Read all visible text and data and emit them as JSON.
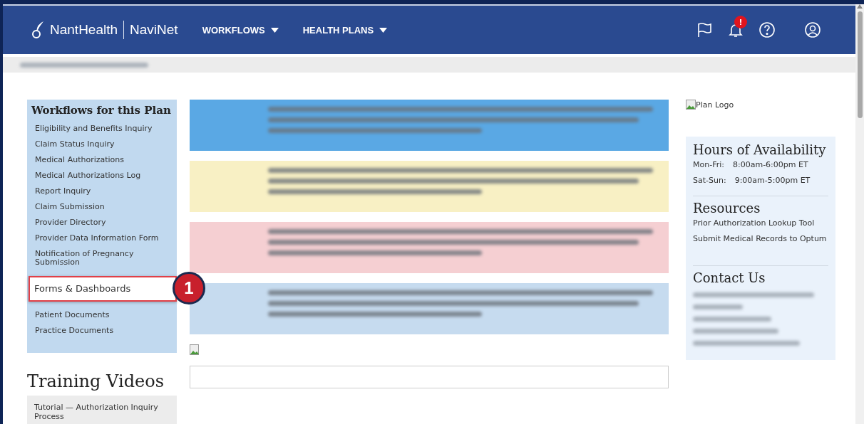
{
  "header": {
    "logo_brand": "NantHealth",
    "logo_product": "NaviNet",
    "nav": [
      {
        "label": "WORKFLOWS"
      },
      {
        "label": "HEALTH PLANS"
      }
    ],
    "notification_badge": "!"
  },
  "workflows": {
    "title": "Workflows for this Plan",
    "items": [
      {
        "label": "Eligibility and Benefits Inquiry",
        "selected": false
      },
      {
        "label": "Claim Status Inquiry",
        "selected": false
      },
      {
        "label": "Medical Authorizations",
        "selected": false
      },
      {
        "label": "Medical Authorizations Log",
        "selected": false
      },
      {
        "label": "Report Inquiry",
        "selected": false
      },
      {
        "label": "Claim Submission",
        "selected": false
      },
      {
        "label": "Provider Directory",
        "selected": false
      },
      {
        "label": "Provider Data Information Form",
        "selected": false
      },
      {
        "label": "Notification of Pregnancy Submission",
        "selected": false
      },
      {
        "label": "Forms & Dashboards",
        "selected": true,
        "callout": "1"
      },
      {
        "label": "Patient Documents",
        "selected": false
      },
      {
        "label": "Practice Documents",
        "selected": false
      }
    ]
  },
  "training": {
    "title": "Training Videos",
    "items": [
      {
        "label": "Tutorial — Authorization Inquiry Process"
      }
    ]
  },
  "banners": [
    {
      "color": "#5aa8e4"
    },
    {
      "color": "#f8f0c4"
    },
    {
      "color": "#f5cfd2"
    },
    {
      "color": "#c6dbef"
    }
  ],
  "sidebar": {
    "logo_alt": "Plan Logo",
    "hours_title": "Hours of Availability",
    "hours": [
      {
        "days": "Mon-Fri:",
        "time": "8:00am-6:00pm ET"
      },
      {
        "days": "Sat-Sun:",
        "time": "9:00am-5:00pm ET"
      }
    ],
    "resources_title": "Resources",
    "resources": [
      "Prior Authorization Lookup Tool",
      "Submit Medical Records to Optum"
    ],
    "contact_title": "Contact Us"
  }
}
